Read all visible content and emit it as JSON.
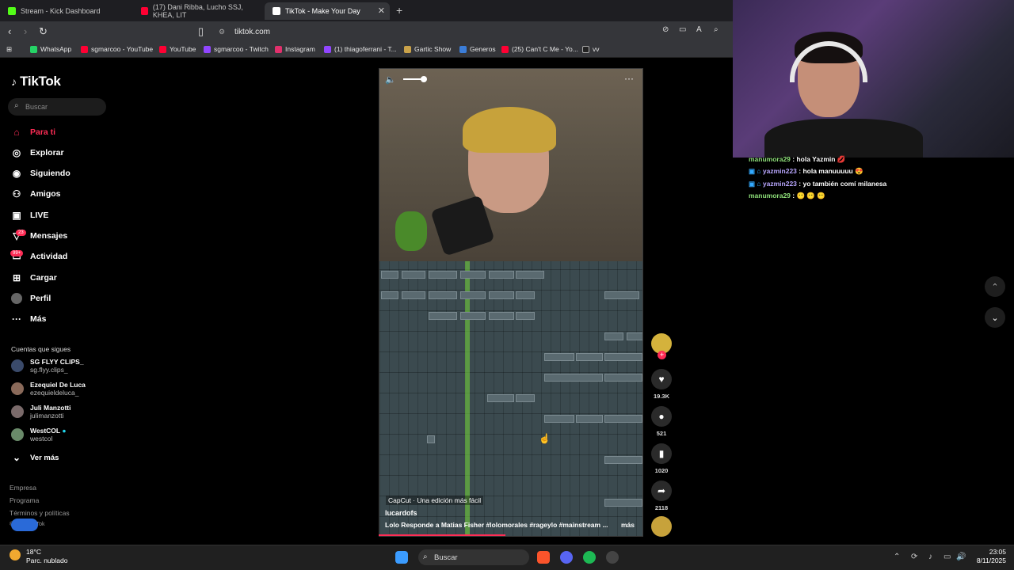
{
  "browser": {
    "tabs": [
      {
        "label": "Stream - Kick Dashboard",
        "color": "#53fc18"
      },
      {
        "label": "(17) Dani Ribba, Lucho SSJ, KHEA, LIT",
        "color": "#ff0033"
      },
      {
        "label": "TikTok - Make Your Day",
        "color": "#ffffff"
      }
    ],
    "url": "tiktok.com",
    "bookmarks": [
      "WhatsApp",
      "sgmarcoo - YouTube",
      "YouTube",
      "sgmarcoo - Twitch",
      "Instagram",
      "(1) thiagoferrani - T...",
      "Gartic Show",
      "Generos",
      "(25) Can't C Me - Yo...",
      "vv"
    ]
  },
  "tiktok": {
    "logo": "TikTok",
    "search_placeholder": "Buscar",
    "nav": [
      {
        "label": "Para ti",
        "icon": "home-icon"
      },
      {
        "label": "Explorar",
        "icon": "compass-icon"
      },
      {
        "label": "Siguiendo",
        "icon": "following-icon"
      },
      {
        "label": "Amigos",
        "icon": "friends-icon"
      },
      {
        "label": "LIVE",
        "icon": "live-icon"
      },
      {
        "label": "Mensajes",
        "icon": "messages-icon",
        "badge": "23"
      },
      {
        "label": "Actividad",
        "icon": "activity-icon",
        "badge": "99+"
      },
      {
        "label": "Cargar",
        "icon": "upload-icon"
      },
      {
        "label": "Perfil",
        "icon": "profile-icon"
      },
      {
        "label": "Más",
        "icon": "more-icon"
      }
    ],
    "following_header": "Cuentas que sigues",
    "following": [
      {
        "name": "SG FLYY CLIPS_",
        "handle": "sg.flyy.clips_"
      },
      {
        "name": "Ezequiel De Luca",
        "handle": "ezequieldeluca_"
      },
      {
        "name": "Juli Manzotti",
        "handle": "julimanzotti"
      },
      {
        "name": "WestCOL",
        "handle": "westcol"
      }
    ],
    "see_more": "Ver más",
    "footer": [
      "Empresa",
      "Programa",
      "Términos y políticas",
      "© 2025 TikTok"
    ],
    "video": {
      "capcut": "CapCut · Una edición más fácil",
      "author": "lucardofs",
      "caption": "Lolo Responde a Matias Fisher #lolomorales #rageylo #mainstream ...",
      "more": "más",
      "progress": 0.48
    },
    "actions": {
      "likes": "19.3K",
      "comments": "521",
      "saves": "1020",
      "shares": "2118"
    }
  },
  "stream_chat": [
    {
      "user": "manumora29",
      "msg": "hola Yazmin",
      "style": "u1"
    },
    {
      "user": "yazmin223",
      "msg": "hola manuuuuu",
      "style": "u2"
    },
    {
      "user": "yazmin223",
      "msg": "yo también comí milanesa",
      "style": "u2"
    },
    {
      "user": "manumora29",
      "msg": "",
      "style": "u1"
    }
  ],
  "taskbar": {
    "weather_temp": "18°C",
    "weather_desc": "Parc. nublado",
    "search": "Buscar",
    "time": "23:05",
    "date": "8/11/2025"
  }
}
